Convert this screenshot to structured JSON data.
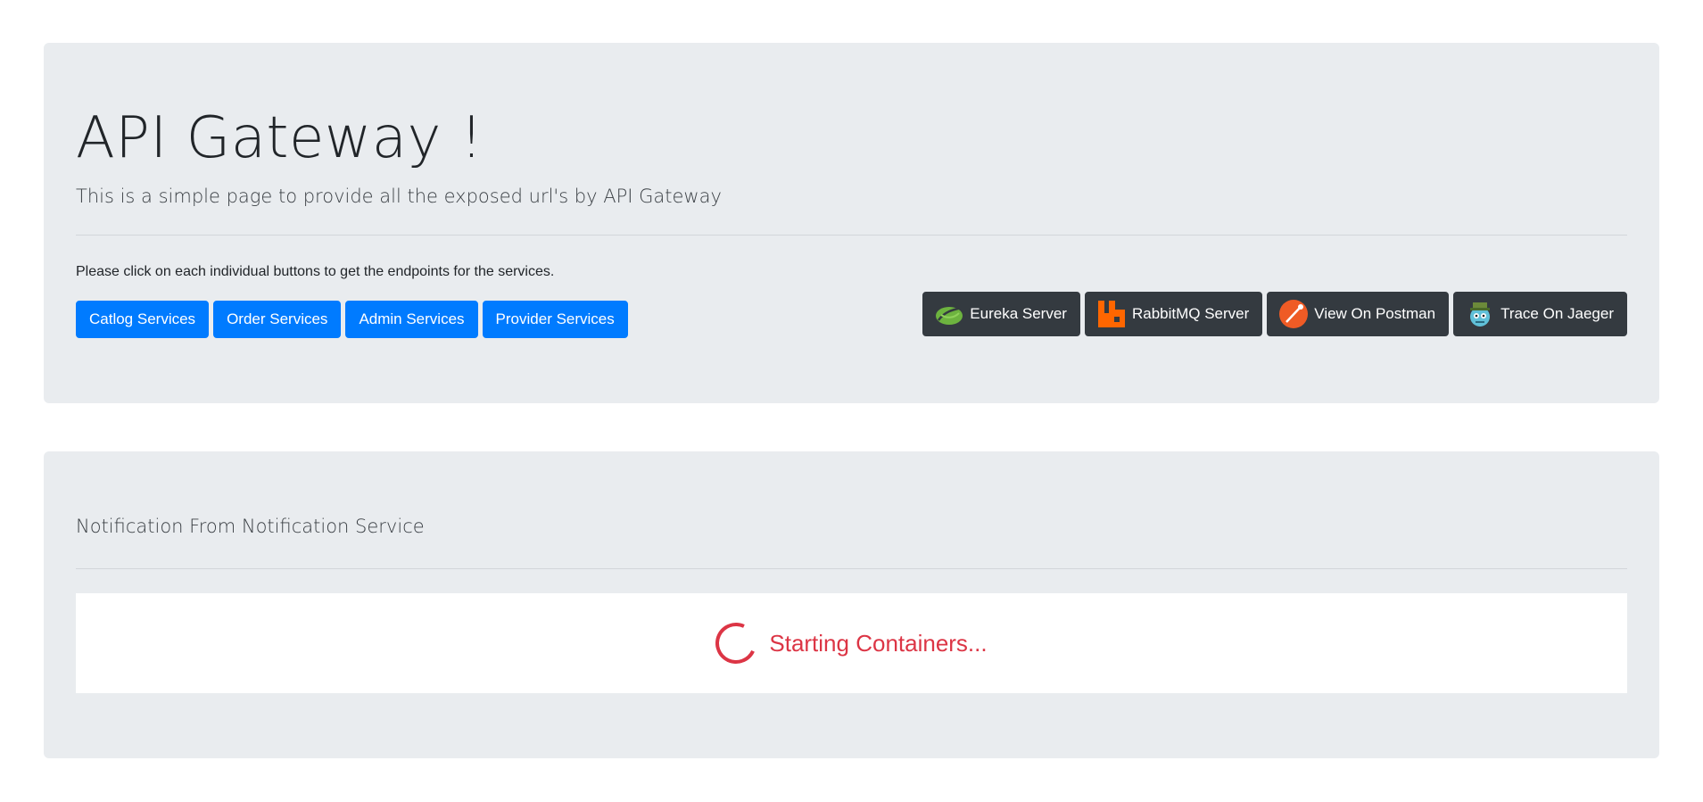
{
  "header": {
    "title": "API Gateway !",
    "lead": "This is a simple page to provide all the exposed url's by API Gateway",
    "help_text": "Please click on each individual buttons to get the endpoints for the services."
  },
  "service_buttons": [
    {
      "label": "Catlog Services"
    },
    {
      "label": "Order Services"
    },
    {
      "label": "Admin Services"
    },
    {
      "label": "Provider Services"
    }
  ],
  "tool_buttons": [
    {
      "label": "Eureka Server",
      "icon": "spring-leaf-icon"
    },
    {
      "label": "RabbitMQ Server",
      "icon": "rabbitmq-icon"
    },
    {
      "label": "View On Postman",
      "icon": "postman-icon"
    },
    {
      "label": "Trace On Jaeger",
      "icon": "jaeger-icon"
    }
  ],
  "notification": {
    "title": "Notification From Notification Service",
    "status_text": "Starting Containers..."
  },
  "colors": {
    "primary": "#007bff",
    "dark": "#343a40",
    "danger": "#dc3545",
    "jumbotron": "#e9ecef"
  }
}
